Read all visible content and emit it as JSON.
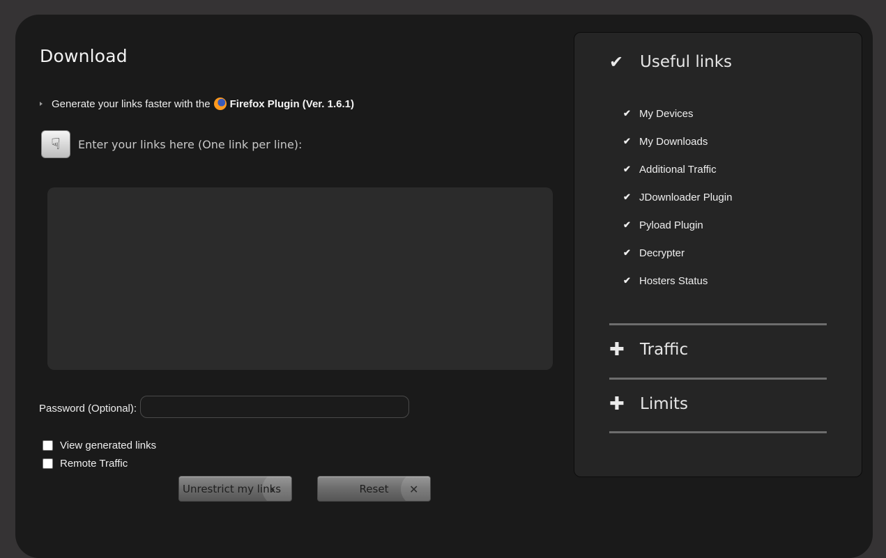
{
  "main": {
    "title": "Download",
    "plugin_text": "Generate your links faster with the",
    "plugin_link": "Firefox Plugin (Ver. 1.6.1)",
    "enter_label": "Enter your links here (One link per line):",
    "links_value": "",
    "password_label": "Password (Optional):",
    "password_value": "",
    "checkboxes": [
      {
        "label": "View generated links",
        "checked": false
      },
      {
        "label": "Remote Traffic",
        "checked": false
      }
    ],
    "unrestrict_label": "Unrestrict my links",
    "reset_label": "Reset"
  },
  "sidebar": {
    "useful_title": "Useful links",
    "links": [
      {
        "label": "My Devices"
      },
      {
        "label": "My Downloads"
      },
      {
        "label": "Additional Traffic"
      },
      {
        "label": "JDownloader Plugin"
      },
      {
        "label": "Pyload Plugin"
      },
      {
        "label": "Decrypter"
      },
      {
        "label": "Hosters Status"
      }
    ],
    "traffic_title": "Traffic",
    "limits_title": "Limits"
  },
  "icons": {
    "check": "check-icon",
    "plus": "plus-icon",
    "hand": "pointing-hand-icon",
    "firefox": "firefox-icon",
    "arrow": "arrow-right-icon",
    "close": "close-icon"
  },
  "colors": {
    "background": "#353334",
    "panel": "#1a1a1a",
    "sidebar": "#252525",
    "textarea": "#2b2b2b"
  }
}
